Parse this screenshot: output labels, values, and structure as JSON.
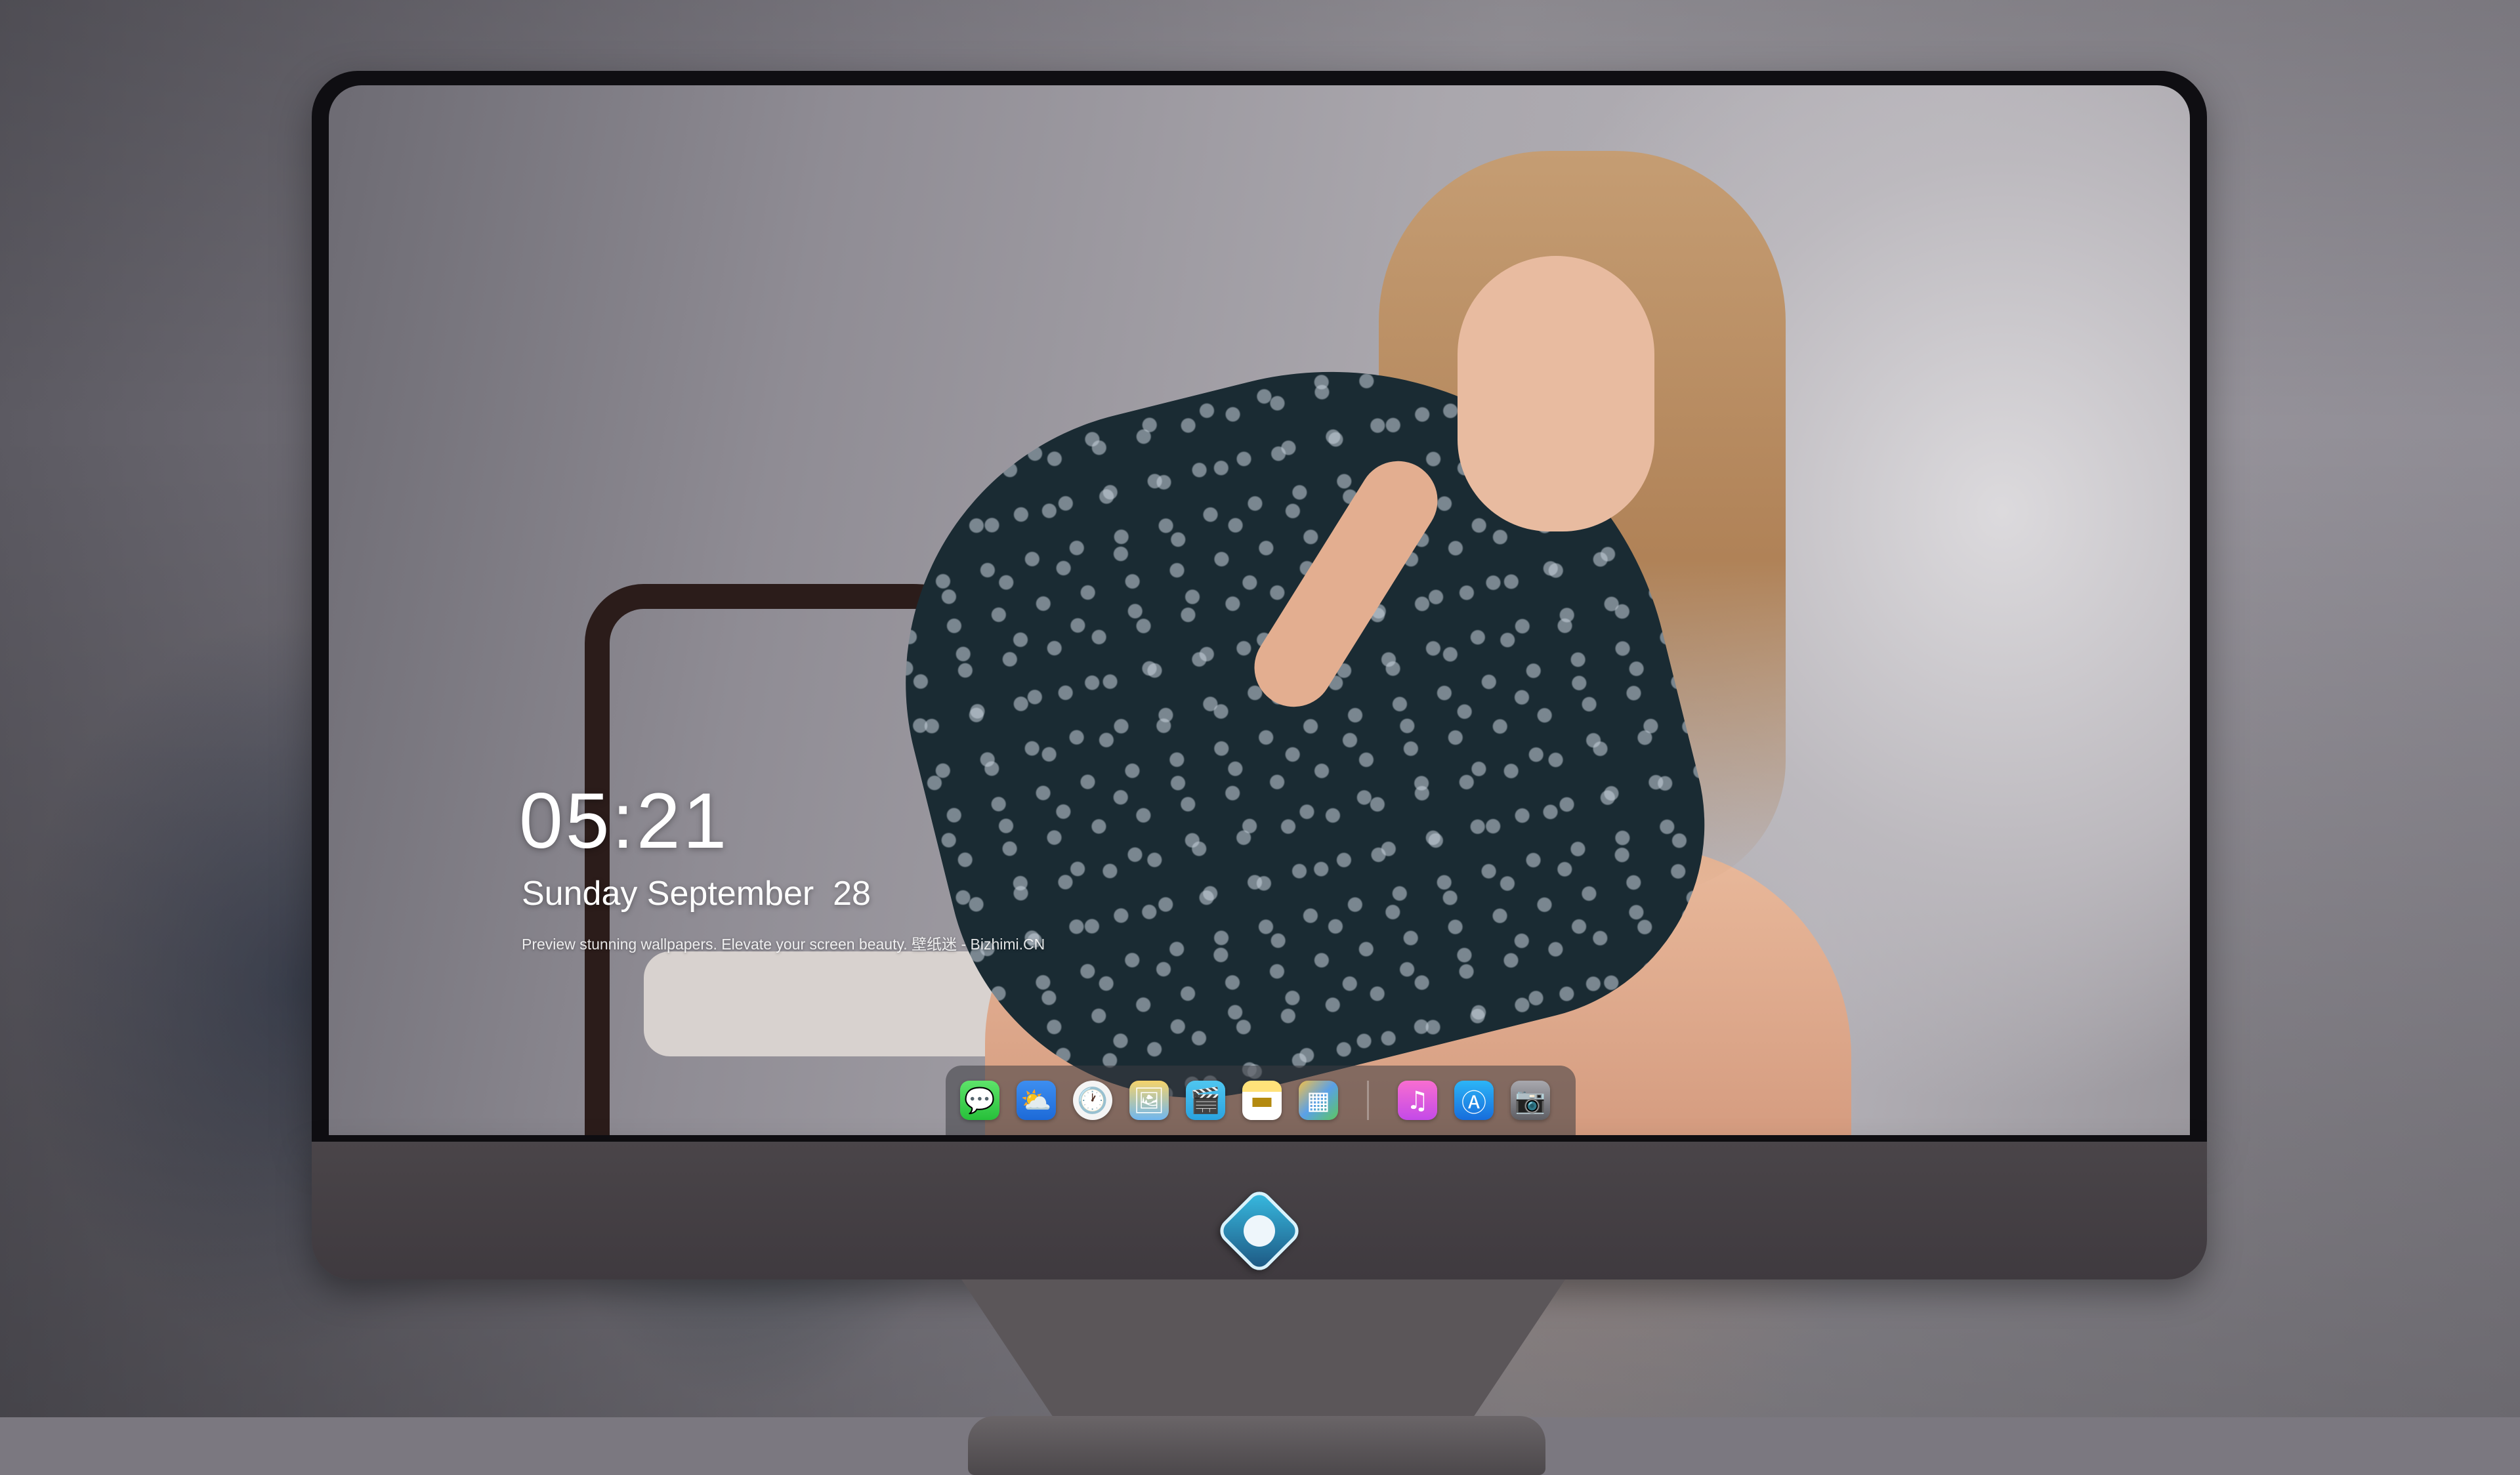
{
  "lock_screen": {
    "time": "05:21",
    "date": "Sunday September  28",
    "tagline": "Preview stunning wallpapers. Elevate your screen beauty. 壁纸迷 - Bizhimi.CN"
  },
  "dock": {
    "apps": [
      {
        "name": "Messages",
        "icon": "messages-icon",
        "glyph": "💬"
      },
      {
        "name": "Weather",
        "icon": "weather-icon",
        "glyph": "⛅"
      },
      {
        "name": "Clock",
        "icon": "clock-icon",
        "glyph": "🕐"
      },
      {
        "name": "Preview",
        "icon": "preview-icon",
        "glyph": "🖼"
      },
      {
        "name": "Clips",
        "icon": "clapperboard-icon",
        "glyph": "🎬"
      },
      {
        "name": "Notes",
        "icon": "notes-icon",
        "glyph": "▬"
      },
      {
        "name": "Photo Booth",
        "icon": "photos-collage-icon",
        "glyph": "▦"
      },
      {
        "name": "Music",
        "icon": "music-note-icon",
        "glyph": "♫"
      },
      {
        "name": "App Store",
        "icon": "app-store-icon",
        "glyph": "Ⓐ"
      },
      {
        "name": "Camera",
        "icon": "camera-icon",
        "glyph": "📷"
      }
    ]
  },
  "colors": {
    "monitor_bezel": "#0f0e12",
    "monitor_chin": "#4a4549",
    "dock_background": "rgba(60,60,66,0.55)",
    "text": "#ffffff"
  }
}
